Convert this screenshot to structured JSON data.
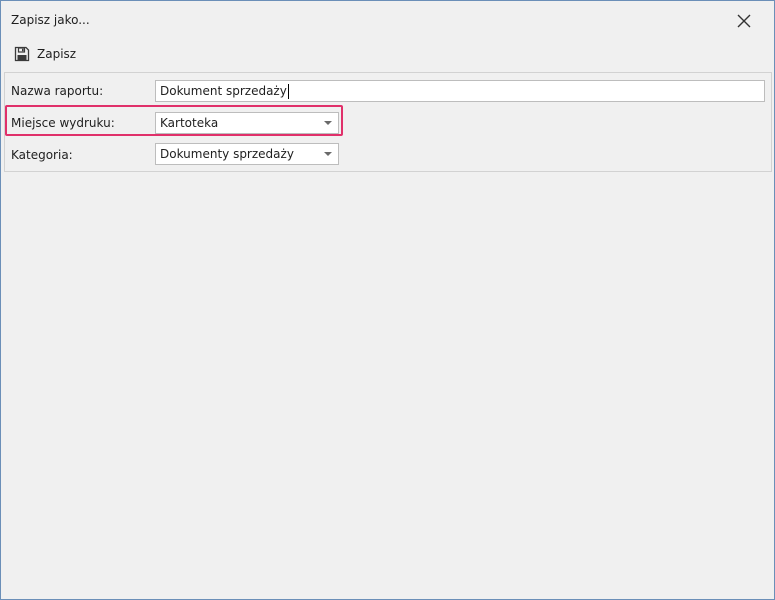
{
  "window": {
    "title": "Zapisz jako..."
  },
  "toolbar": {
    "save_label": "Zapisz"
  },
  "form": {
    "report_name": {
      "label": "Nazwa raportu:",
      "value": "Dokument sprzedaży"
    },
    "print_location": {
      "label": "Miejsce wydruku:",
      "value": "Kartoteka"
    },
    "category": {
      "label": "Kategoria:",
      "value": "Dokumenty sprzedaży"
    }
  },
  "icons": {
    "close": "close-icon",
    "save": "floppy-disk-icon",
    "dropdown": "chevron-down-icon"
  },
  "colors": {
    "highlight": "#e0306a",
    "window_border": "#6b8fb8",
    "background": "#f0f0f0"
  }
}
